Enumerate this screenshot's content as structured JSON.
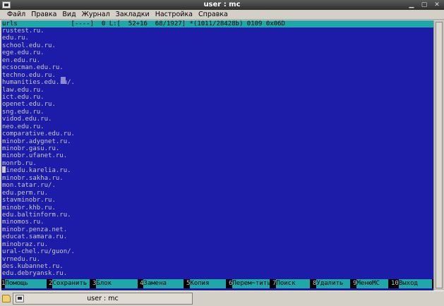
{
  "window": {
    "title": "user : mc"
  },
  "menu": [
    "Файл",
    "Правка",
    "Вид",
    "Журнал",
    "Закладки",
    "Настройка",
    "Справка"
  ],
  "editor": {
    "status": "urls              [----]  0 L:[  52+16  68/1927] *(1011/28428b) 0109 0x06D",
    "lines": [
      "rustest.ru.",
      "edu.ru.",
      "school.edu.ru.",
      "ege.edu.ru.",
      "en.edu.ru.",
      "ecsocman.edu.ru.",
      "techno.edu.ru.",
      "humanities.edu.ru/.",
      "law.edu.ru.",
      "ict.edu.ru.",
      "openet.edu.ru.",
      "sng.edu.ru.",
      "vidod.edu.ru.",
      "neo.edu.ru.",
      "comparative.edu.ru.",
      "minobr.adygnet.ru.",
      "minobr.gasu.ru.",
      "minobr.ufanet.ru.",
      "monrb.ru.",
      "minedu.karelia.ru.",
      "minobr.sakha.ru.",
      "mon.tatar.ru/.",
      "edu.perm.ru.",
      "stavminobr.ru.",
      "minobr.khb.ru.",
      "edu.baltinform.ru.",
      "minomos.ru.",
      "minobr.penza.net.",
      "educat.samara.ru.",
      "minobraz.ru.",
      "ural-chel.ru/guon/.",
      "vrnedu.ru.",
      "des.kubannet.ru.",
      "edu.debryansk.ru."
    ]
  },
  "fkeys": [
    {
      "num": "1",
      "label": "Помощь"
    },
    {
      "num": "2",
      "label": "Сохранить"
    },
    {
      "num": "3",
      "label": "Блок"
    },
    {
      "num": "4",
      "label": "Замена"
    },
    {
      "num": "5",
      "label": "Копия"
    },
    {
      "num": "6",
      "label": "Перем~тить"
    },
    {
      "num": "7",
      "label": "Поиск"
    },
    {
      "num": "8",
      "label": "Удалить"
    },
    {
      "num": "9",
      "label": "МенюMC"
    },
    {
      "num": "10",
      "label": "Выход"
    }
  ],
  "taskbar": {
    "task_label": "user : mc"
  },
  "colors": {
    "terminal_bg": "#1c1ca8",
    "status_bg": "#20a8a8",
    "text": "#c8c8c8"
  }
}
